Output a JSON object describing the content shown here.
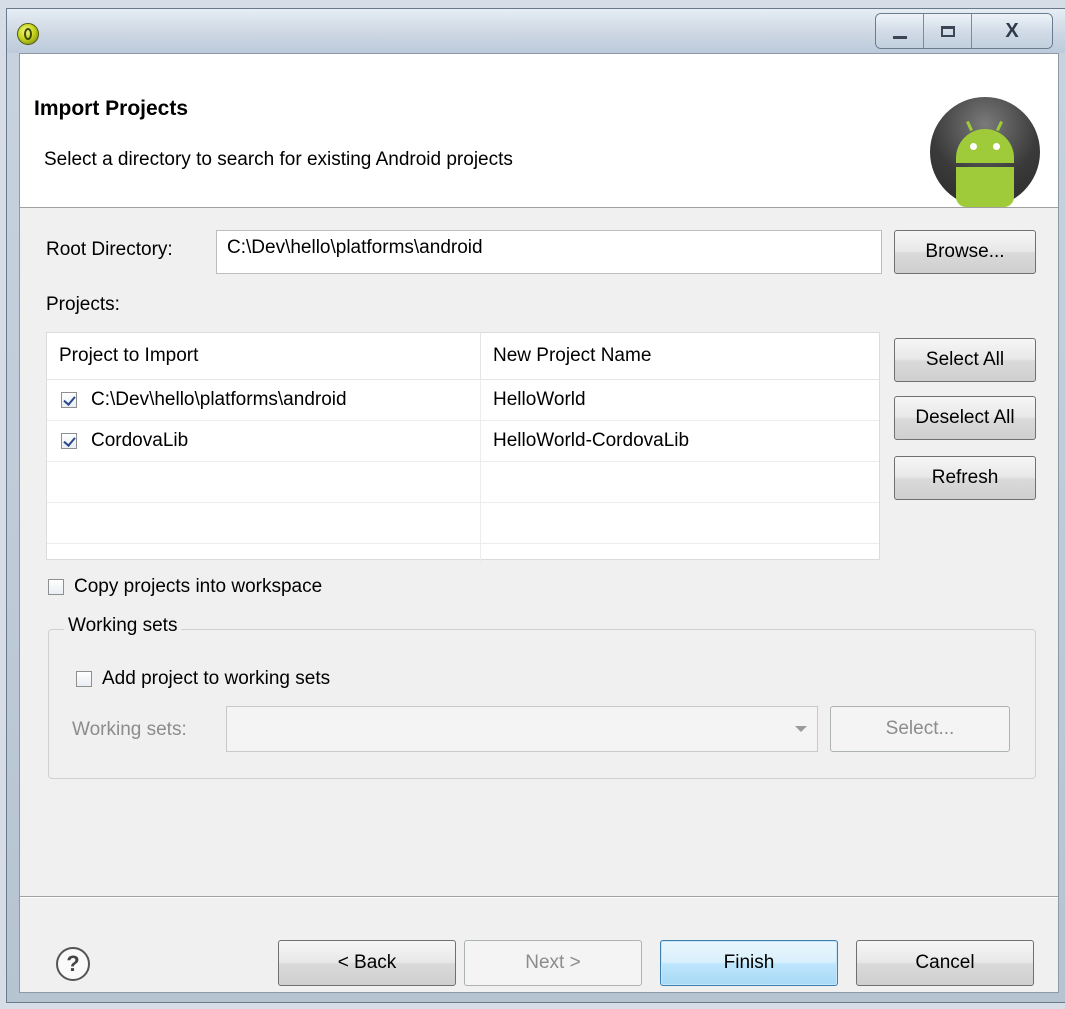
{
  "window": {
    "icon": "eclipse-adt-icon",
    "controls": {
      "minimize": "minimize-icon",
      "maximize": "maximize-icon",
      "close_label": "X"
    }
  },
  "banner": {
    "title": "Import Projects",
    "description": "Select a directory to search for existing Android projects",
    "logo": "android-logo"
  },
  "root_directory": {
    "label": "Root Directory:",
    "value": "C:\\Dev\\hello\\platforms\\android",
    "browse_label": "Browse..."
  },
  "projects": {
    "label": "Projects:",
    "columns": [
      "Project to Import",
      "New Project Name"
    ],
    "rows": [
      {
        "checked": true,
        "project": "C:\\Dev\\hello\\platforms\\android",
        "name": "HelloWorld"
      },
      {
        "checked": true,
        "project": "CordovaLib",
        "name": "HelloWorld-CordovaLib"
      }
    ],
    "select_all_label": "Select All",
    "deselect_all_label": "Deselect All",
    "refresh_label": "Refresh"
  },
  "copy_into_workspace": {
    "label": "Copy projects into workspace",
    "checked": false
  },
  "working_sets": {
    "legend": "Working sets",
    "add_label": "Add project to working sets",
    "add_checked": false,
    "field_label": "Working sets:",
    "select_label": "Select..."
  },
  "footer": {
    "help_icon": "help-icon",
    "help_glyph": "?",
    "back_label": "< Back",
    "next_label": "Next >",
    "finish_label": "Finish",
    "cancel_label": "Cancel"
  }
}
